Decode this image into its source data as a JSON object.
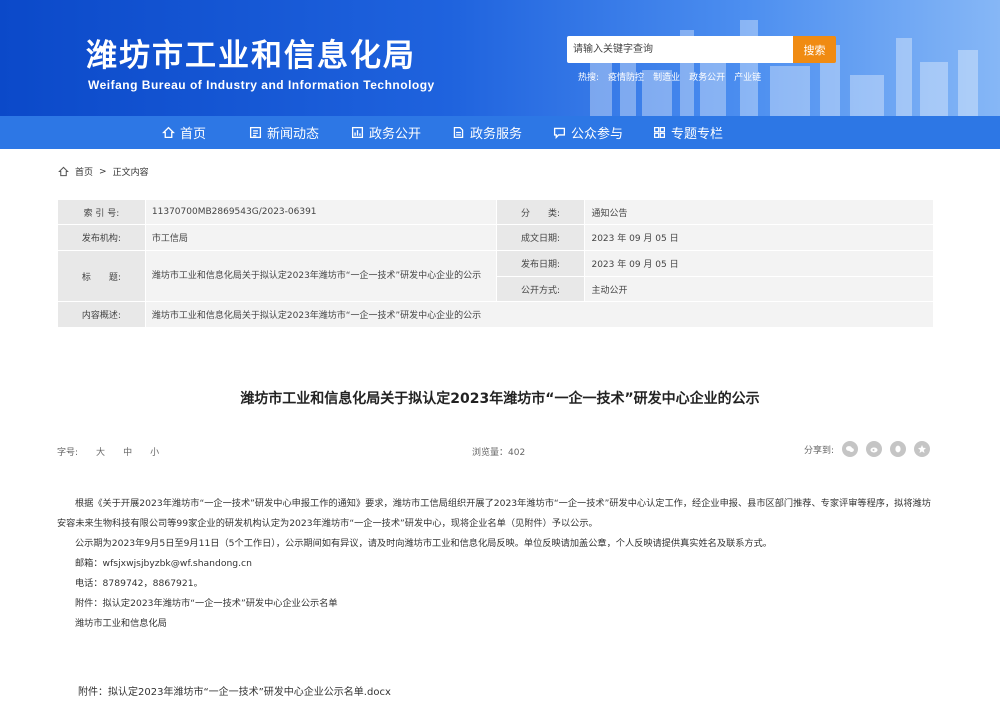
{
  "header": {
    "title": "潍坊市工业和信息化局",
    "subtitle": "Weifang Bureau of Industry and Information Technology",
    "search_placeholder": "请输入关键字查询",
    "search_button": "搜索",
    "hot_label": "热搜:",
    "hot_links": [
      "疫情防控",
      "制造业",
      "政务公开",
      "产业链"
    ]
  },
  "nav": {
    "items": [
      {
        "label": "首页",
        "icon": "home-icon"
      },
      {
        "label": "新闻动态",
        "icon": "news-icon"
      },
      {
        "label": "政务公开",
        "icon": "chart-icon"
      },
      {
        "label": "政务服务",
        "icon": "document-icon"
      },
      {
        "label": "公众参与",
        "icon": "chat-icon"
      },
      {
        "label": "专题专栏",
        "icon": "grid-icon"
      }
    ]
  },
  "breadcrumb": {
    "home": "首页",
    "separator": ">",
    "current": "正文内容"
  },
  "info": {
    "index_label": "索 引 号:",
    "index_value": "11370700MB2869543G/2023-06391",
    "category_label": "分　　类:",
    "category_value": "通知公告",
    "issuer_label": "发布机构:",
    "issuer_value": "市工信局",
    "created_label": "成文日期:",
    "created_value": "2023 年 09 月 05 日",
    "title_label": "标　　题:",
    "title_value": "潍坊市工业和信息化局关于拟认定2023年潍坊市“一企一技术”研发中心企业的公示",
    "published_label": "发布日期:",
    "published_value": "2023 年 09 月 05 日",
    "open_label": "公开方式:",
    "open_value": "主动公开",
    "summary_label": "内容概述:",
    "summary_value": "潍坊市工业和信息化局关于拟认定2023年潍坊市“一企一技术”研发中心企业的公示"
  },
  "article": {
    "title": "潍坊市工业和信息化局关于拟认定2023年潍坊市“一企一技术”研发中心企业的公示",
    "font_label": "字号:",
    "font_large": "大",
    "font_medium": "中",
    "font_small": "小",
    "views": "浏览量：402",
    "share_label": "分享到:",
    "share_icons": [
      "wechat-icon",
      "weibo-icon",
      "qq-icon",
      "qzone-icon"
    ],
    "paragraph1": "根据《关于开展2023年潍坊市“一企一技术”研发中心申报工作的通知》要求，潍坊市工信局组织开展了2023年潍坊市“一企一技术”研发中心认定工作，经企业申报、县市区部门推荐、专家评审等程序，拟将潍坊安容未来生物科技有限公司等99家企业的研发机构认定为2023年潍坊市“一企一技术”研发中心，现将企业名单（见附件）予以公示。",
    "paragraph2": "公示期为2023年9月5日至9月11日（5个工作日），公示期间如有异议，请及时向潍坊市工业和信息化局反映。单位反映请加盖公章，个人反映请提供真实姓名及联系方式。",
    "email": "邮箱：wfsjxwjsjbyzbk@wf.shandong.cn",
    "phone": "电话：8789742，8867921。",
    "attachment_note": "附件：拟认定2023年潍坊市“一企一技术”研发中心企业公示名单",
    "signature": "潍坊市工业和信息化局",
    "attachment_link": "附件：拟认定2023年潍坊市“一企一技术”研发中心企业公示名单.docx"
  },
  "colors": {
    "nav": "#2d77e5",
    "search_button": "#f08b12",
    "banner_start": "#0b49c9",
    "banner_end": "#86b7f6"
  }
}
